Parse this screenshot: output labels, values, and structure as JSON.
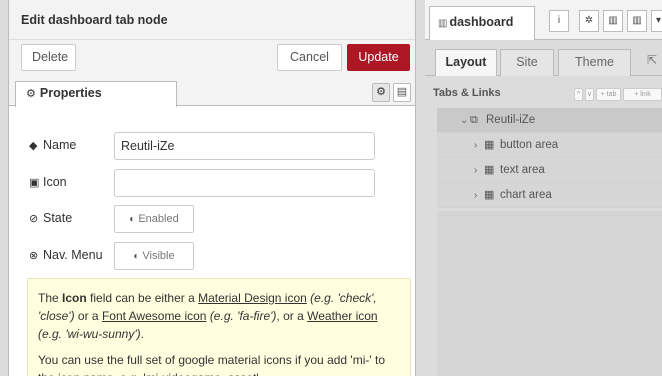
{
  "left": {
    "title": "Edit dashboard tab node",
    "buttons": {
      "delete": "Delete",
      "cancel": "Cancel",
      "update": "Update"
    },
    "tab": {
      "label": "Properties",
      "icon": "gear-icon"
    },
    "fields": {
      "name": {
        "label": "Name",
        "value": "Reutil-iZe",
        "icon": "tag-icon"
      },
      "icon": {
        "label": "Icon",
        "value": "",
        "icon": "file-image-icon"
      },
      "state": {
        "label": "State",
        "toggle": "Enabled",
        "icon": "ban-icon"
      },
      "nav": {
        "label": "Nav. Menu",
        "toggle": "Visible",
        "icon": "eye-slash-icon"
      }
    },
    "tip": {
      "p1_a": "The ",
      "p1_icon": "Icon",
      "p1_b": " field can be either a ",
      "p1_link1": "Material Design icon",
      "p1_c": " ",
      "p1_eg1": "(e.g. 'check', 'close')",
      "p1_d": " or a ",
      "p1_link2": "Font Awesome icon",
      "p1_e": " ",
      "p1_eg2": "(e.g. 'fa-fire')",
      "p1_f": ", or a ",
      "p1_link3": "Weather icon",
      "p1_g": " ",
      "p1_eg3": "(e.g. 'wi-wu-sunny')",
      "p1_h": ".",
      "p2": "You can use the full set of google material icons if you add 'mi-' to the icon name. e.g. 'mi-videogame_asset'."
    }
  },
  "right": {
    "tab_label": "dashboard",
    "sub_tabs": [
      "Layout",
      "Site",
      "Theme"
    ],
    "section_title": "Tabs & Links",
    "mini_buttons": [
      "^",
      "v",
      "+ tab",
      "+ link"
    ],
    "tree": {
      "tab": "Reutil-iZe",
      "groups": [
        "button area",
        "text area",
        "chart area"
      ]
    }
  }
}
